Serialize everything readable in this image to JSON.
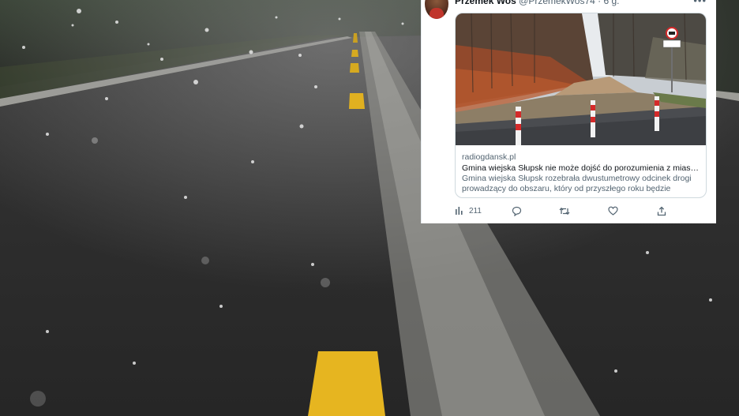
{
  "tweet": {
    "author_name": "Przemek Woś",
    "author_handle": "@PrzemekWos74",
    "separator": "·",
    "time": "6 g.",
    "more_icon": "more-dots-icon",
    "card": {
      "domain": "radiogdansk.pl",
      "title": "Gmina wiejska Słupsk nie może dojść do porozumienia z miastem, wię...",
      "description": "Gmina wiejska Słupsk rozebrała dwustumetrowy odcinek drogi prowadzący do obszaru, który od przyszłego roku będzie częścią miast..."
    },
    "actions": {
      "views_count": "211",
      "views_icon": "analytics-bar-icon",
      "reply_icon": "reply-bubble-icon",
      "retweet_icon": "retweet-icon",
      "like_icon": "heart-icon",
      "share_icon": "share-upload-icon"
    }
  },
  "colors": {
    "road_line_yellow": "#e0b020",
    "text_primary": "#0f1419",
    "text_secondary": "#536471",
    "card_border": "#cfd9de"
  }
}
